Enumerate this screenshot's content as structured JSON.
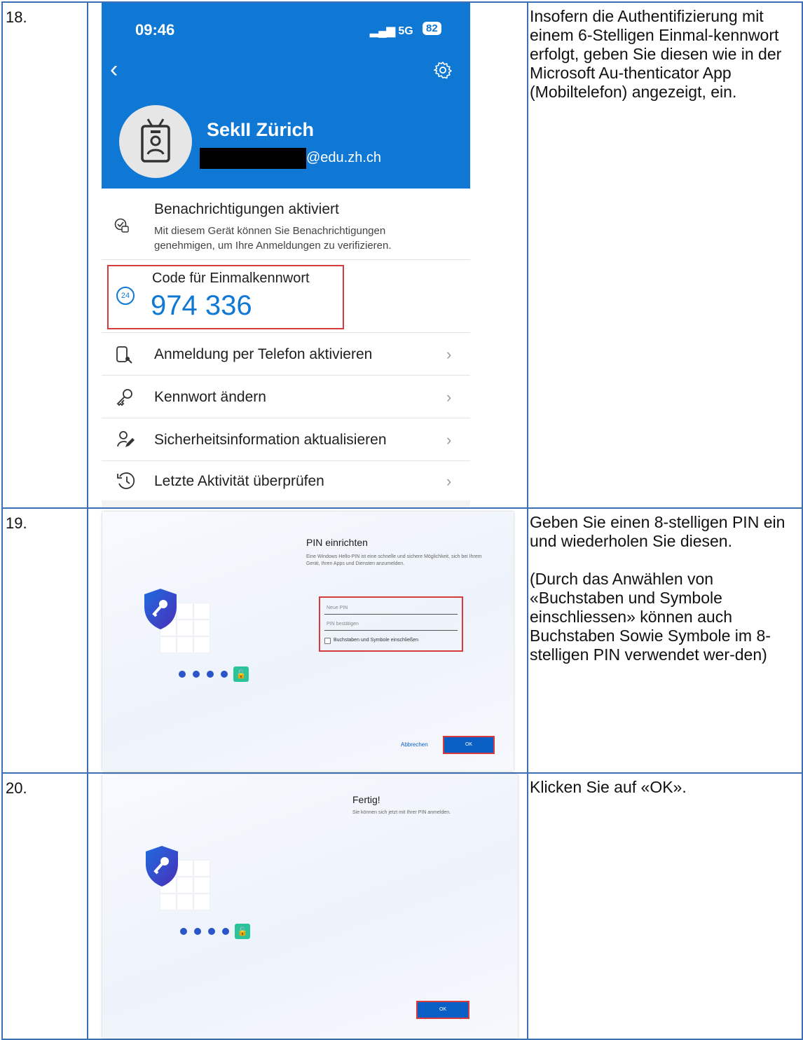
{
  "steps": [
    {
      "number": "18.",
      "description": [
        "Insofern die Authentifizierung mit einem 6-Stelligen Einmal-kennwort erfolgt, geben Sie diesen wie in der Microsoft Au-thenticator App (Mobiltelefon) angezeigt, ein."
      ],
      "phone": {
        "time": "09:46",
        "signal": "5G",
        "battery": "82",
        "back_icon": "chevron-left-icon",
        "settings_icon": "gear-icon",
        "account_name": "SekII Zürich",
        "account_domain": "@edu.zh.ch",
        "notifications_title": "Benachrichtigungen aktiviert",
        "notifications_text": "Mit diesem Gerät können Sie Benachrichtigungen genehmigen, um Ihre Anmeldungen zu verifizieren.",
        "otp_label": "Code für Einmalkennwort",
        "otp_code": "974 336",
        "otp_timer": "24",
        "menu": [
          {
            "label": "Anmeldung per Telefon aktivieren",
            "icon": "phone-sign-in-icon"
          },
          {
            "label": "Kennwort ändern",
            "icon": "key-icon"
          },
          {
            "label": "Sicherheitsinformation aktualisieren",
            "icon": "person-edit-icon"
          },
          {
            "label": "Letzte Aktivität überprüfen",
            "icon": "history-icon"
          }
        ]
      }
    },
    {
      "number": "19.",
      "description": [
        "Geben Sie einen 8-stelligen PIN ein und wiederholen Sie diesen.",
        "(Durch das Anwählen von «Buchstaben und Symbole einschliessen» können auch Buchstaben Sowie Symbole im 8-stelligen PIN verwendet wer-den)"
      ],
      "dialog": {
        "title": "PIN einrichten",
        "subtitle": "Eine Windows Hello-PIN ist eine schnelle und sichere Möglichkeit, sich bei Ihrem Gerät, Ihren Apps und Diensten anzumelden.",
        "new_pin_placeholder": "Neue PIN",
        "confirm_pin_placeholder": "PIN bestätigen",
        "checkbox_label": "Buchstaben und Symbole einschließen",
        "cancel_label": "Abbrechen",
        "ok_label": "OK"
      }
    },
    {
      "number": "20.",
      "description": [
        "Klicken Sie auf «OK»."
      ],
      "dialog": {
        "title": "Fertig!",
        "subtitle": "Sie können sich jetzt mit Ihrer PIN anmelden.",
        "ok_label": "OK"
      }
    }
  ],
  "colors": {
    "table_border": "#3b6fb6",
    "authenticator_blue": "#0f78d4",
    "highlight_red": "#d83b3b",
    "windows_button": "#0a5fc4"
  }
}
